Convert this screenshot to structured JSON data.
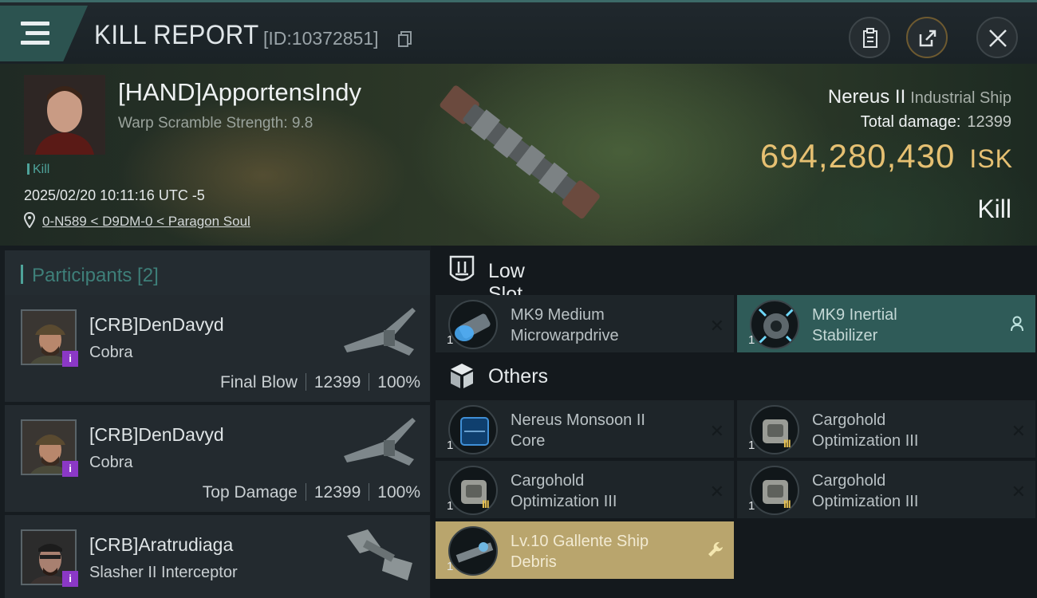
{
  "header": {
    "title": "KILL REPORT",
    "report_id": "[ID:10372851]",
    "icons": [
      "menu-icon",
      "copy-icon",
      "clipboard-icon",
      "share-icon",
      "close-icon"
    ],
    "accent_color": "#2c5350"
  },
  "victim": {
    "name": "[HAND]ApportensIndy",
    "warp_scramble": "Warp Scramble Strength: 9.8",
    "kill_tag": "Kill",
    "timestamp": "2025/02/20 10:11:16 UTC -5",
    "location": "0-N589 < D9DM-0 < Paragon Soul",
    "ship_name": "Nereus II",
    "ship_class": "Industrial Ship",
    "total_damage_label": "Total damage:",
    "total_damage": "12399",
    "isk_value": "694,280,430",
    "isk_unit": "ISK",
    "result": "Kill",
    "isk_color": "#e6c072"
  },
  "participants": {
    "title": "Participants [2]",
    "rows": [
      {
        "name": "[CRB]DenDavyd",
        "ship": "Cobra",
        "role": "Final Blow",
        "damage": "12399",
        "percent": "100%"
      },
      {
        "name": "[CRB]DenDavyd",
        "ship": "Cobra",
        "role": "Top Damage",
        "damage": "12399",
        "percent": "100%"
      },
      {
        "name": "[CRB]Aratrudiaga",
        "ship": "Slasher II Interceptor"
      }
    ]
  },
  "low_slot": {
    "title": "Low Slot",
    "items": [
      {
        "qty": "1",
        "line1": "MK9 Medium",
        "line2": "Microwarpdrive",
        "state": "destroyed"
      },
      {
        "qty": "1",
        "line1": "MK9 Inertial",
        "line2": "Stabilizer",
        "state": "dropped"
      }
    ]
  },
  "others": {
    "title": "Others",
    "items": [
      {
        "qty": "1",
        "line1": "Nereus Monsoon II",
        "line2": "Core",
        "state": "destroyed"
      },
      {
        "qty": "1",
        "line1": "Cargohold",
        "line2": "Optimization III",
        "state": "destroyed"
      },
      {
        "qty": "1",
        "line1": "Cargohold",
        "line2": "Optimization III",
        "state": "destroyed"
      },
      {
        "qty": "1",
        "line1": "Cargohold",
        "line2": "Optimization III",
        "state": "destroyed"
      },
      {
        "qty": "1",
        "line1": "Lv.10 Gallente Ship",
        "line2": "Debris",
        "state": "dropped"
      }
    ]
  }
}
